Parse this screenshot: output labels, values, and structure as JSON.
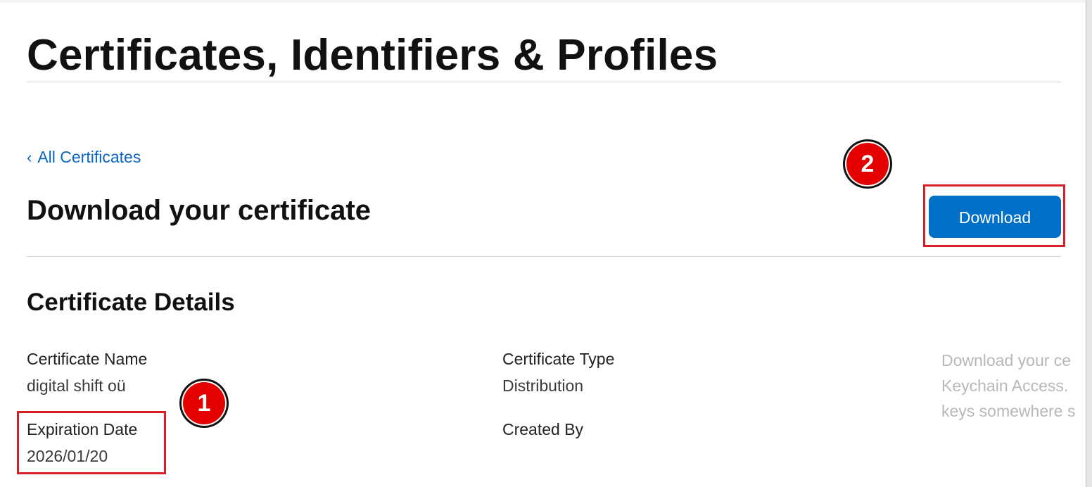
{
  "header": {
    "title": "Certificates, Identifiers & Profiles"
  },
  "nav": {
    "back_label": "All Certificates",
    "back_chevron": "‹"
  },
  "section": {
    "title": "Download your certificate",
    "download_label": "Download"
  },
  "details": {
    "title": "Certificate Details",
    "fields": {
      "certificate_name_label": "Certificate Name",
      "certificate_name_value": "digital shift oü",
      "expiration_date_label": "Expiration Date",
      "expiration_date_value": "2026/01/20",
      "certificate_type_label": "Certificate Type",
      "certificate_type_value": "Distribution",
      "created_by_label": "Created By"
    }
  },
  "side_note": {
    "lines": [
      "Download your ce",
      "Keychain Access.",
      "keys somewhere s"
    ]
  },
  "annotations": {
    "marker_1": "1",
    "marker_2": "2"
  },
  "colors": {
    "link": "#0a66c2",
    "button": "#0070c9",
    "highlight": "#d61f26",
    "marker": "#e50000"
  }
}
